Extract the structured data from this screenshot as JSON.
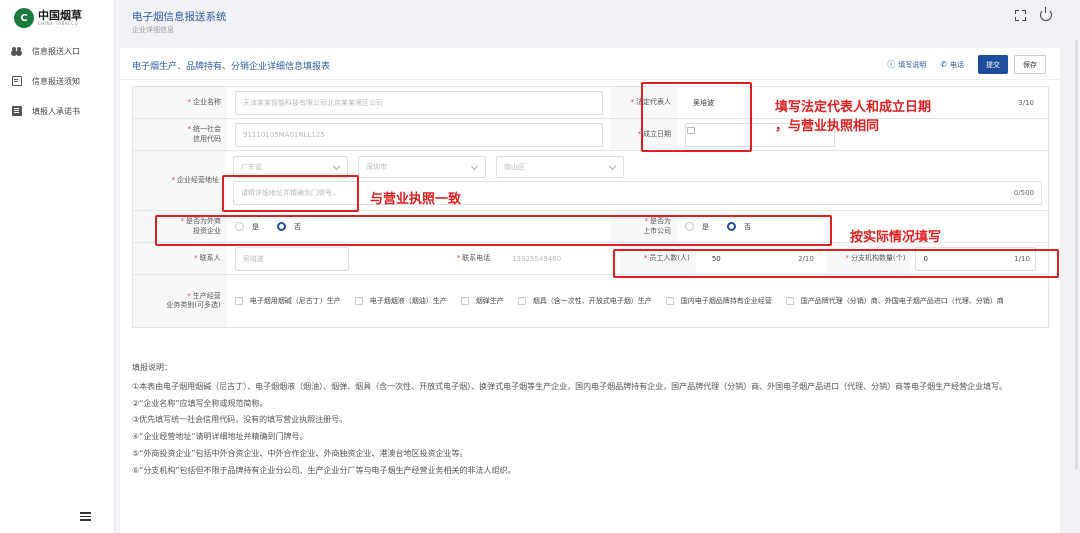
{
  "brand": {
    "logo_cn": "中国烟草",
    "logo_en": "CHINA TOBACCO"
  },
  "sidebar": {
    "items": [
      {
        "label": "信息报送入口",
        "icon": "people-icon"
      },
      {
        "label": "信息报送须知",
        "icon": "document-icon"
      },
      {
        "label": "填报人承诺书",
        "icon": "book-icon"
      }
    ]
  },
  "header": {
    "title": "电子烟信息报送系统",
    "subtitle": "企业详细信息"
  },
  "card": {
    "title": "电子烟生产、品牌持有、分销企业详细信息填报表",
    "help_label": "填写说明",
    "phone_label": "电话",
    "submit_label": "提交",
    "save_label": "保存"
  },
  "form": {
    "company_name": {
      "label": "企业名称",
      "placeholder": "天津某某智能科技有限公司北京某某限区公司"
    },
    "legal_rep": {
      "label": "法定代表人",
      "value": "吴培波",
      "counter": "3/10"
    },
    "credit_code": {
      "label": "统一社会信用代码",
      "placeholder": "91110105MA01NLL125"
    },
    "found_date": {
      "label": "成立日期"
    },
    "address": {
      "label": "企业经营地址",
      "province": "广东省",
      "city": "深圳市",
      "district": "南山区",
      "placeholder": "请精详细地址并精确到门牌号。",
      "counter": "0/500"
    },
    "foreign": {
      "label_1": "是否为外商",
      "label_2": "投资企业",
      "yes": "是",
      "no": "否"
    },
    "listed": {
      "label_1": "是否为",
      "label_2": "上市公司",
      "yes": "是",
      "no": "否"
    },
    "contact": {
      "label": "联系人",
      "placeholder": "吴培波"
    },
    "phone": {
      "label": "联系电话",
      "placeholder": "13925549460"
    },
    "staff": {
      "label": "员工人数(人)",
      "value": "50",
      "counter": "2/10"
    },
    "branches": {
      "label": "分支机构数量(个)",
      "value": "0",
      "counter": "1/10"
    },
    "business": {
      "label_1": "生产经营",
      "label_2": "业务类别(可多选)",
      "options": [
        "电子烟用烟碱（尼古丁）生产",
        "电子烟烟液（烟油）生产",
        "烟弹生产",
        "烟具（含一次性、开放式电子烟）生产",
        "国内电子烟品牌持有企业经营",
        "国产品牌代理（分销）商、外国电子烟产品进口（代理、分销）商"
      ]
    }
  },
  "annotations": {
    "legal_note_1": "填写法定代表人和成立日期",
    "legal_note_2": "，与营业执照相同",
    "address_note": "与营业执照一致",
    "actual_note": "按实际情况填写"
  },
  "notes": {
    "title": "填报说明：",
    "items": [
      "①本表由电子烟用烟碱（尼古丁）、电子烟烟液（烟油）、烟弹、烟具（含一次性、开放式电子烟）、换弹式电子烟等生产企业，国内电子烟品牌持有企业，国产品牌代理（分销）商、外国电子烟产品进口（代理、分销）商等电子烟生产经营企业填写。",
      "②“企业名称”应填写全称或规范简称。",
      "③优先填写统一社会信用代码，没有的填写营业执照注册号。",
      "④“企业经营地址”请明详细地址并精确到门牌号。",
      "⑤“外商投资企业”包括中外合资企业、中外合作企业、外商独资企业、港澳台地区投资企业等。",
      "⑥“分支机构”包括但不限于品牌持有企业分公司、生产企业分厂等与电子烟生产经营业务相关的非法人组织。"
    ]
  }
}
